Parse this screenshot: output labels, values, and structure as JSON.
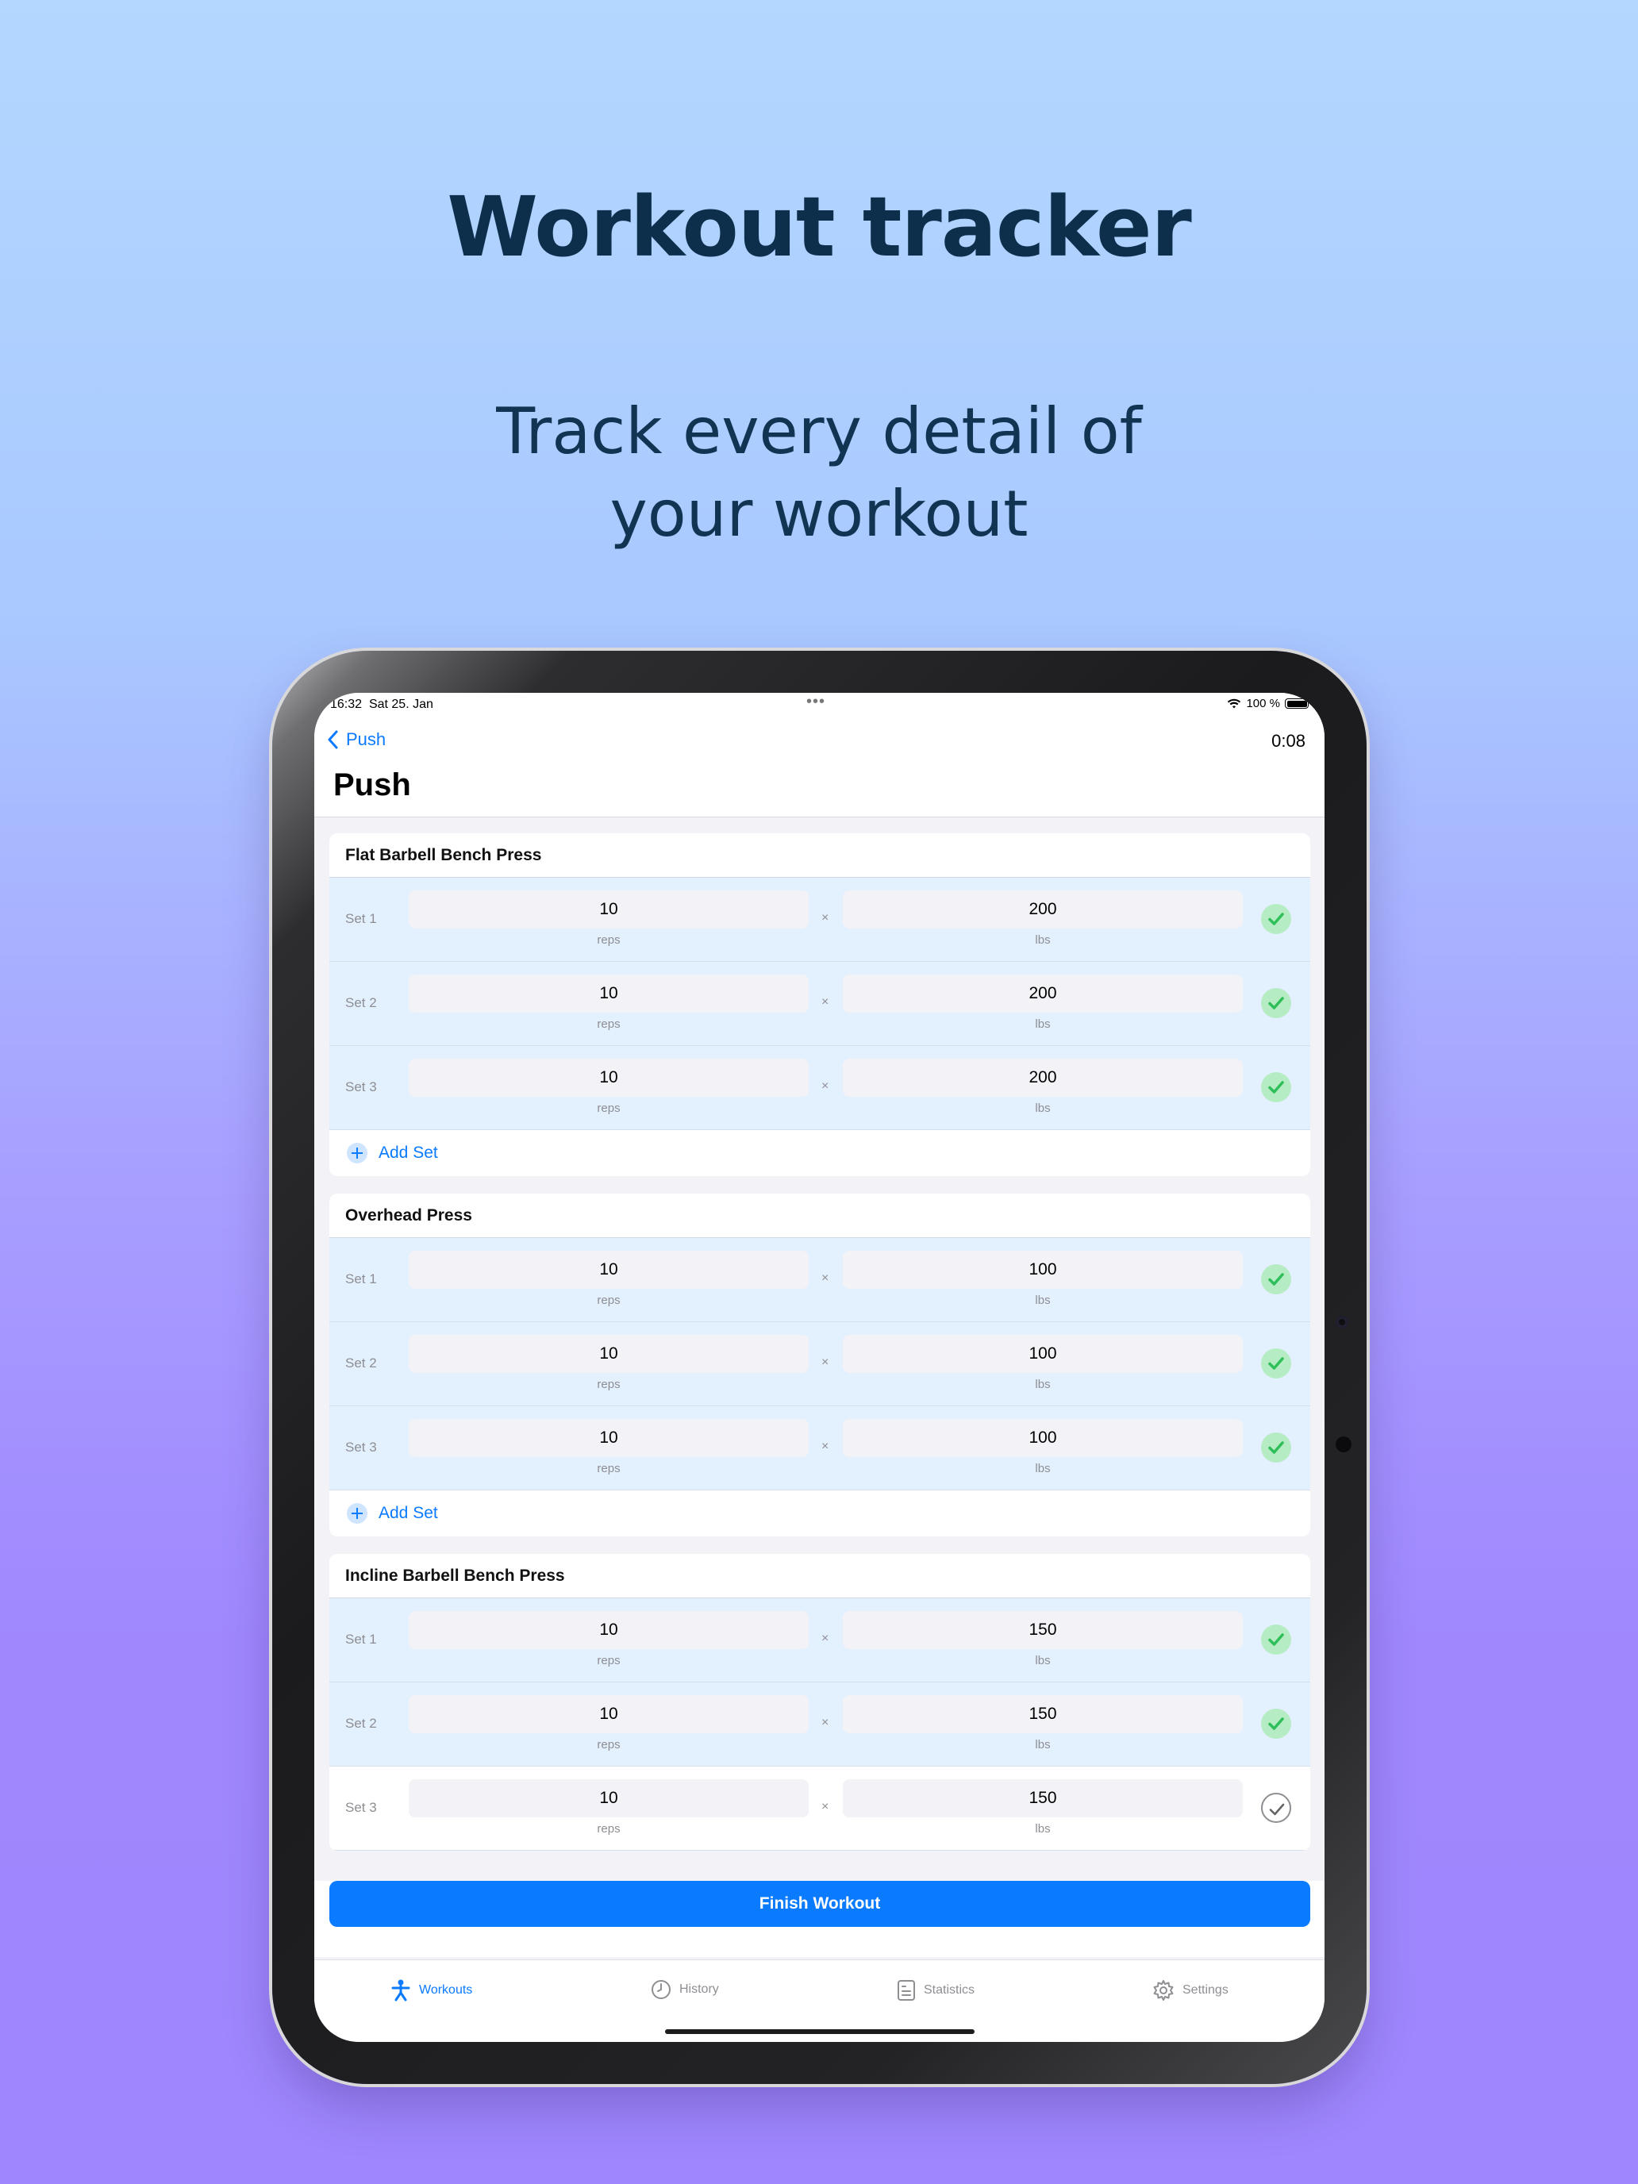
{
  "headline": "Workout tracker",
  "subline": [
    "Track every detail of",
    "your workout"
  ],
  "status": {
    "time": "16:32",
    "date": "Sat 25. Jan",
    "battery": "100 %"
  },
  "nav": {
    "back_label": "Push",
    "timer": "0:08",
    "title": "Push"
  },
  "labels": {
    "times": "×",
    "reps": "reps",
    "lbs": "lbs",
    "add_set": "Add Set"
  },
  "exercises": [
    {
      "name": "Flat Barbell Bench Press",
      "sets": [
        {
          "label": "Set 1",
          "reps": "10",
          "weight": "200",
          "done": true
        },
        {
          "label": "Set 2",
          "reps": "10",
          "weight": "200",
          "done": true
        },
        {
          "label": "Set 3",
          "reps": "10",
          "weight": "200",
          "done": true
        }
      ]
    },
    {
      "name": "Overhead Press",
      "sets": [
        {
          "label": "Set 1",
          "reps": "10",
          "weight": "100",
          "done": true
        },
        {
          "label": "Set 2",
          "reps": "10",
          "weight": "100",
          "done": true
        },
        {
          "label": "Set 3",
          "reps": "10",
          "weight": "100",
          "done": true
        }
      ]
    },
    {
      "name": "Incline Barbell Bench Press",
      "sets": [
        {
          "label": "Set 1",
          "reps": "10",
          "weight": "150",
          "done": true
        },
        {
          "label": "Set 2",
          "reps": "10",
          "weight": "150",
          "done": true
        },
        {
          "label": "Set 3",
          "reps": "10",
          "weight": "150",
          "done": false
        }
      ]
    }
  ],
  "finish_label": "Finish Workout",
  "tabs": [
    {
      "label": "Workouts",
      "icon": "figure-icon",
      "active": true
    },
    {
      "label": "History",
      "icon": "clock-icon",
      "active": false
    },
    {
      "label": "Statistics",
      "icon": "chart-icon",
      "active": false
    },
    {
      "label": "Settings",
      "icon": "gear-icon",
      "active": false
    }
  ],
  "colors": {
    "accent": "#0a7aff",
    "done_row": "#e3f0fe",
    "check_bg": "#b6ecc3",
    "check_mark": "#2fbf5a",
    "headline": "#0d2f4c"
  }
}
